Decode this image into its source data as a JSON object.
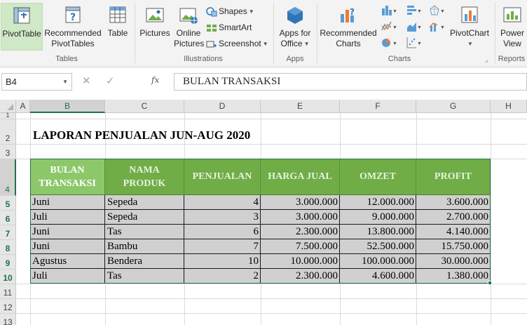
{
  "ribbon": {
    "tables": {
      "group_label": "Tables",
      "pivot_table": "PivotTable",
      "recommended_pivot_1": "Recommended",
      "recommended_pivot_2": "PivotTables",
      "table": "Table"
    },
    "illustrations": {
      "group_label": "Illustrations",
      "pictures": "Pictures",
      "online_1": "Online",
      "online_2": "Pictures",
      "shapes": "Shapes",
      "smartart": "SmartArt",
      "screenshot": "Screenshot"
    },
    "apps": {
      "group_label": "Apps",
      "apps_for_1": "Apps for",
      "apps_for_2": "Office"
    },
    "charts": {
      "group_label": "Charts",
      "recommended_1": "Recommended",
      "recommended_2": "Charts",
      "pivot_chart": "PivotChart"
    },
    "reports": {
      "group_label": "Reports",
      "power_1": "Power",
      "power_2": "View"
    }
  },
  "formula_bar": {
    "name_box": "B4",
    "fx": "fx",
    "content": "BULAN TRANSAKSI"
  },
  "columns": [
    "A",
    "B",
    "C",
    "D",
    "E",
    "F",
    "G",
    "H"
  ],
  "rows": [
    "1",
    "2",
    "3",
    "4",
    "5",
    "6",
    "7",
    "8",
    "9",
    "10",
    "11",
    "12",
    "13"
  ],
  "sheet": {
    "title": "LAPORAN PENJUALAN JUN-AUG 2020",
    "headers": [
      [
        "BULAN",
        "TRANSAKSI"
      ],
      [
        "NAMA",
        "PRODUK"
      ],
      [
        "PENJUALAN",
        ""
      ],
      [
        "HARGA JUAL",
        ""
      ],
      [
        "OMZET",
        ""
      ],
      [
        "PROFIT",
        ""
      ]
    ],
    "rows": [
      [
        "Juni",
        "Sepeda",
        "4",
        "3.000.000",
        "12.000.000",
        "3.600.000"
      ],
      [
        "Juli",
        "Sepeda",
        "3",
        "3.000.000",
        "9.000.000",
        "2.700.000"
      ],
      [
        "Juni",
        "Tas",
        "6",
        "2.300.000",
        "13.800.000",
        "4.140.000"
      ],
      [
        "Juni",
        "Bambu",
        "7",
        "7.500.000",
        "52.500.000",
        "15.750.000"
      ],
      [
        "Agustus",
        "Bendera",
        "10",
        "10.000.000",
        "100.000.000",
        "30.000.000"
      ],
      [
        "Juli",
        "Tas",
        "2",
        "2.300.000",
        "4.600.000",
        "1.380.000"
      ]
    ]
  },
  "colors": {
    "header_green": "#70ad47",
    "selected_header_green": "#8cc86a",
    "excel_accent": "#217346",
    "data_fill": "#d0d0d0"
  }
}
